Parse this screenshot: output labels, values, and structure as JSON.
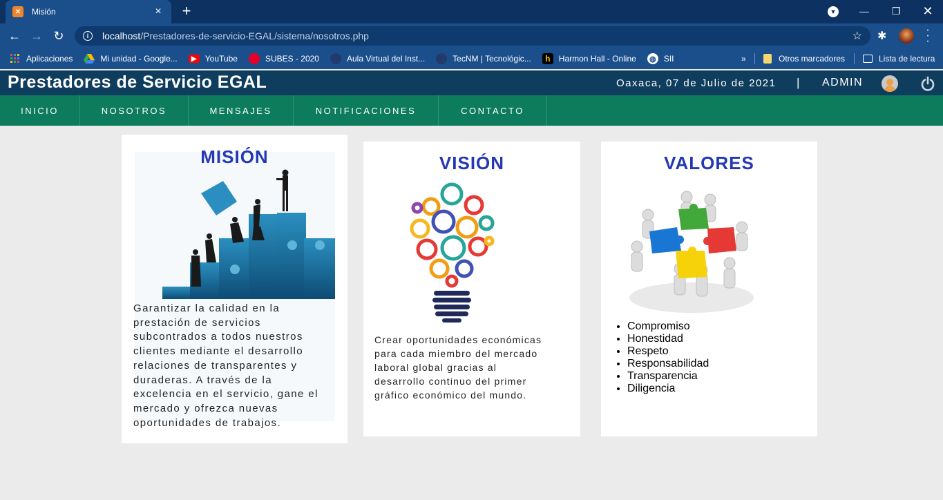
{
  "browser": {
    "tab_title": "Misión",
    "url_host": "localhost",
    "url_path": "/Prestadores-de-servicio-EGAL/sistema/nosotros.php",
    "bookmarks": [
      {
        "label": "Aplicaciones",
        "icon": "apps-grid-icon"
      },
      {
        "label": "Mi unidad - Google...",
        "icon": "google-drive-icon"
      },
      {
        "label": "YouTube",
        "icon": "youtube-icon"
      },
      {
        "label": "SUBES - 2020",
        "icon": "subes-icon"
      },
      {
        "label": "Aula Virtual del Inst...",
        "icon": "aula-virtual-icon"
      },
      {
        "label": "TecNM | Tecnológic...",
        "icon": "tecnm-icon"
      },
      {
        "label": "Harmon Hall - Online",
        "icon": "harmon-hall-icon"
      },
      {
        "label": "SII",
        "icon": "globe-icon"
      }
    ],
    "other_bookmarks": "Otros marcadores",
    "reading_list": "Lista de lectura"
  },
  "site": {
    "title": "Prestadores de Servicio EGAL",
    "date": "Oaxaca, 07 de Julio de 2021",
    "separator": "|",
    "user": "ADMIN",
    "nav": [
      "INICIO",
      "NOSOTROS",
      "MENSAJES",
      "NOTIFICACIONES",
      "CONTACTO"
    ]
  },
  "cards": {
    "mision": {
      "title": "MISIÓN",
      "lines": [
        "Garantizar la calidad en la",
        "prestación de servicios",
        "subcontrados a todos nuestros",
        "clientes mediante el desarrollo",
        "relaciones de transparentes y",
        "duraderas. A través de la",
        "excelencia en el servicio, gane el",
        "mercado y ofrezca nuevas",
        "oportunidades de trabajos."
      ]
    },
    "vision": {
      "title": "VISIÓN",
      "lines": [
        "Crear oportunidades económicas",
        "para cada miembro del mercado",
        "laboral global gracias al",
        "desarrollo continuo del primer",
        "gráfico económico del mundo."
      ]
    },
    "valores": {
      "title": "VALORES",
      "items": [
        "Compromiso",
        "Honestidad",
        "Respeto",
        "Responsabilidad",
        "Transparencia",
        "Diligencia"
      ]
    }
  },
  "colors": {
    "chrome_dark": "#0d3160",
    "chrome": "#1b4f8c",
    "header": "#0f3d5e",
    "nav": "#0c7c5c",
    "title_blue": "#2438b3"
  }
}
